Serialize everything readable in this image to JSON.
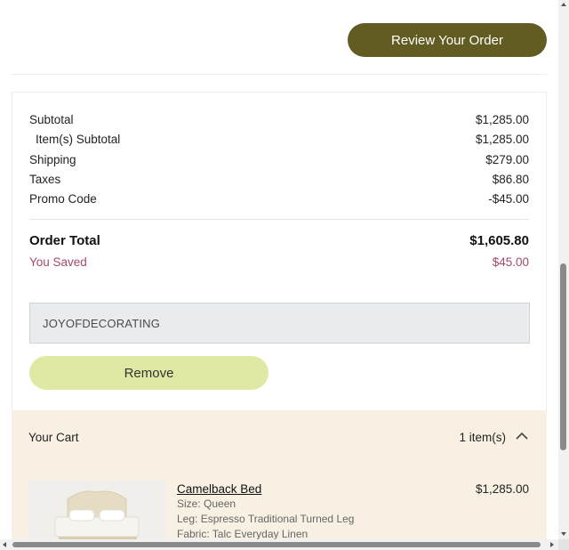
{
  "header": {
    "review_button": "Review Your Order"
  },
  "summary": {
    "rows": [
      {
        "label": "Subtotal",
        "value": "$1,285.00"
      },
      {
        "label": "Item(s) Subtotal",
        "value": "$1,285.00"
      },
      {
        "label": "Shipping",
        "value": "$279.00"
      },
      {
        "label": "Taxes",
        "value": "$86.80"
      },
      {
        "label": "Promo Code",
        "value": "-$45.00"
      }
    ],
    "total_label": "Order Total",
    "total_value": "$1,605.80",
    "saved_label": "You Saved",
    "saved_value": "$45.00",
    "saved_color": "#a5486e"
  },
  "promo": {
    "code": "JOYOFDECORATING",
    "remove_label": "Remove"
  },
  "cart": {
    "title": "Your Cart",
    "count": "1 item(s)",
    "toggle_icon": "chevron-up-icon",
    "item": {
      "name": "Camelback Bed",
      "price": "$1,285.00",
      "size": "Size: Queen",
      "leg": "Leg: Espresso Traditional Turned Leg",
      "fabric": "Fabric: Talc Everyday Linen",
      "image_icon": "bed-product-image"
    }
  },
  "colors": {
    "primary_button": "#625b22",
    "secondary_button": "#dfe9a3",
    "cart_background": "#f8f1e3"
  }
}
